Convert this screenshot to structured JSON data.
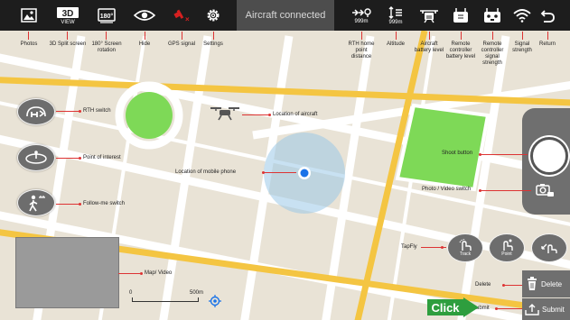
{
  "topbar": {
    "view_label": "VIEW",
    "rotation_label": "180°",
    "connection_status": "Aircraft connected",
    "rth_distance": "999m",
    "altitude": "999m"
  },
  "callouts": {
    "photos": "Photos",
    "split_screen": "3D Split screen",
    "screen_rotation": "180° Screen rotation",
    "hide": "Hide",
    "gps_signal": "GPS signal",
    "settings": "Settings",
    "rth_home_distance": "RTH home point distance",
    "altitude": "Altitude",
    "aircraft_battery": "Aircraft battery level",
    "rc_battery": "Remote controller battery level",
    "rc_signal": "Remote controller signal strength",
    "signal_strength": "Signal strength",
    "return": "Return",
    "rth_switch": "RTH switch",
    "location_aircraft": "Location of aircraft",
    "point_of_interest": "Point of interest",
    "location_phone": "Location of mobile phone",
    "follow_me": "Follow-me switch",
    "shoot_button": "Shoot button",
    "photo_video_switch": "Photo / Video switch",
    "tapfly": "TapFly",
    "map_video": "Map/ Video",
    "delete": "Delete",
    "submit": "Submit"
  },
  "map": {
    "scale_start": "0",
    "scale_end": "500m"
  },
  "actions": {
    "track": "Track",
    "point": "Point"
  },
  "right_panel": {
    "delete_label": "Delete",
    "submit_label": "Submit"
  },
  "click_label": "Click",
  "colors": {
    "topbar": "#1d1d1d",
    "map_bg": "#e9e3d6",
    "road": "#ffffff",
    "major_road": "#f4c542",
    "park": "#7ed957",
    "callout_line": "#dd3333",
    "click_arrow": "#2e9e3e"
  }
}
